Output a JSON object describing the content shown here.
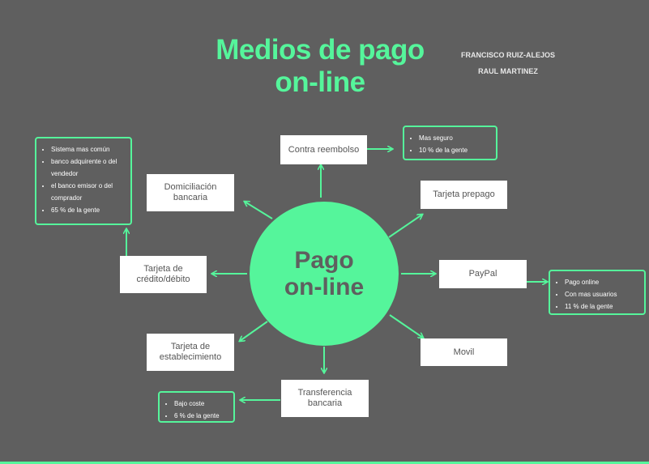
{
  "title": {
    "line1": "Medios de pago",
    "line2": "on-line"
  },
  "authors": [
    "FRANCISCO RUIZ-ALEJOS",
    "RAUL MARTINEZ"
  ],
  "hub": {
    "line1": "Pago",
    "line2": "on-line"
  },
  "nodes": {
    "contra_reembolso": "Contra reembolso",
    "domiciliacion": "Domiciliación bancaria",
    "tarjeta_prepago": "Tarjeta prepago",
    "tarjeta_credito": "Tarjeta de crédito/débito",
    "paypal": "PayPal",
    "tarjeta_establecimiento": "Tarjeta de establecimiento",
    "movil": "Movil",
    "transferencia": "Transferencia bancaria"
  },
  "notes": {
    "contra_reembolso": [
      "Mas seguro",
      "10 % de la gente"
    ],
    "tarjeta_credito": [
      "Sistema mas común",
      "banco adquirente o del vendedor",
      "el banco emisor o del comprador",
      "65 % de la gente"
    ],
    "paypal": [
      "Pago online",
      "Con mas usuarios",
      "11 % de la gente"
    ],
    "transferencia": [
      "Bajo coste",
      "6 % de la gente"
    ]
  },
  "colors": {
    "background": "#5f5f5f",
    "accent": "#55f59b",
    "box": "#ffffff"
  }
}
